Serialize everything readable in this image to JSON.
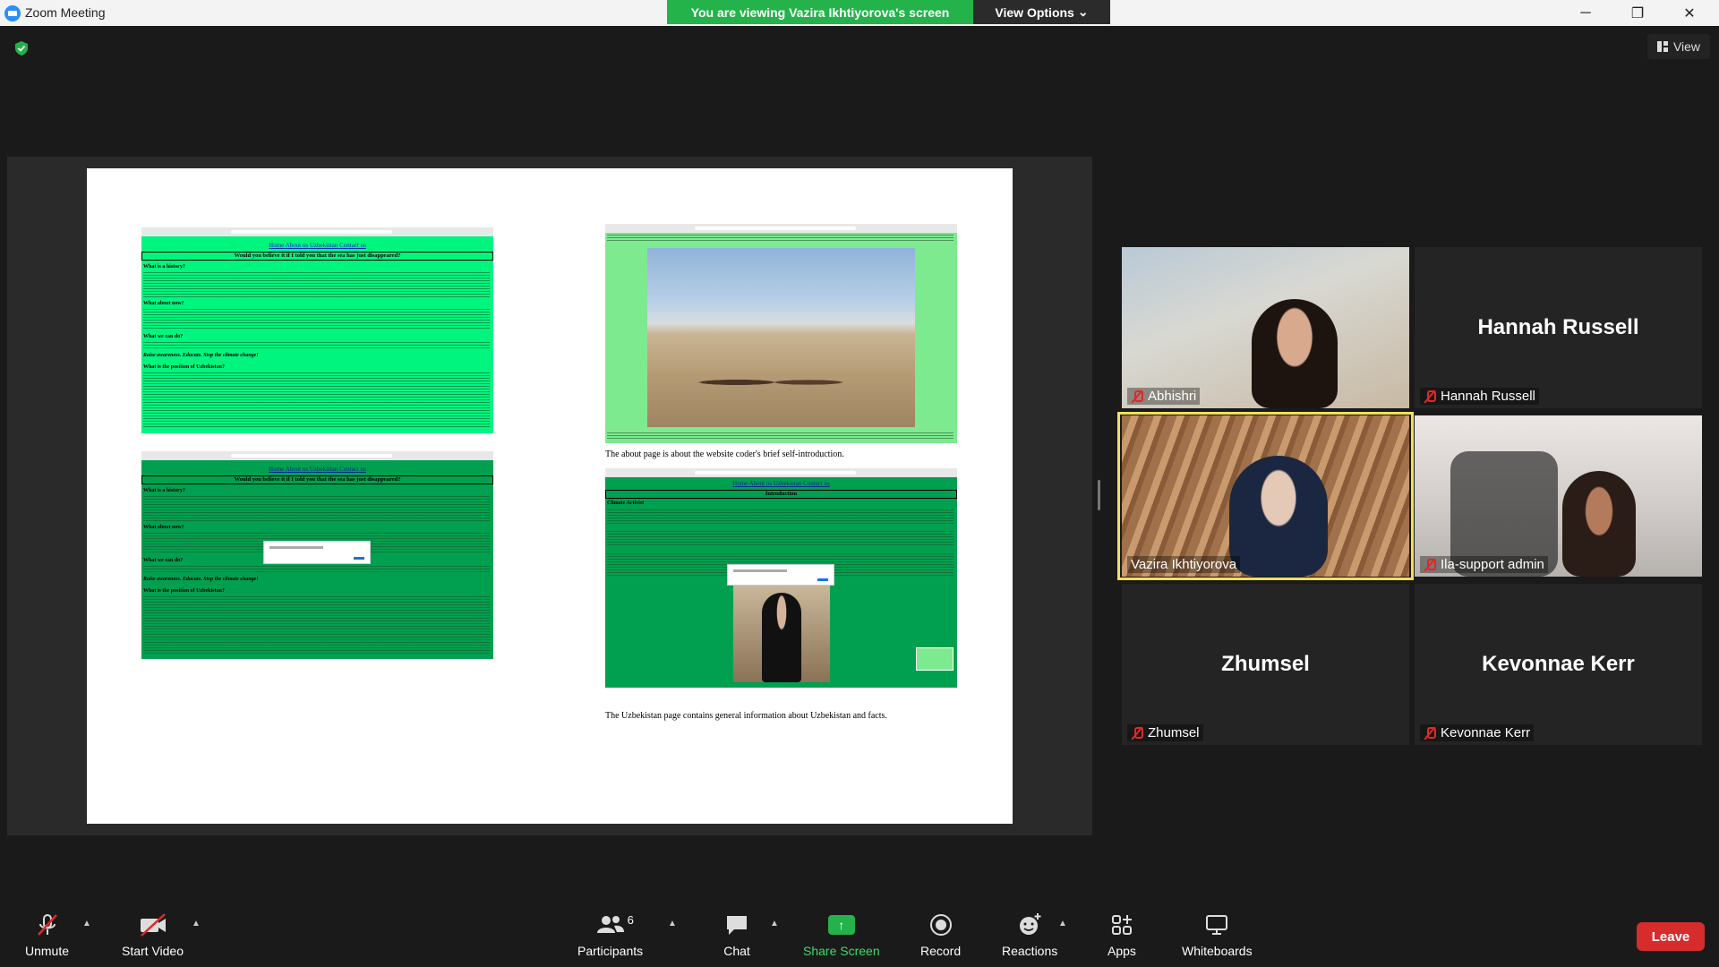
{
  "window": {
    "title": "Zoom Meeting",
    "controls": {
      "minimize": "─",
      "restore": "❐",
      "close": "✕"
    }
  },
  "banner": {
    "viewing_text": "You are viewing Vazira Ikhtiyorova's screen",
    "view_options_label": "View Options"
  },
  "view_button": {
    "label": "View"
  },
  "shared_slide": {
    "caption_about": "The about page is about the website coder's brief self-introduction.",
    "caption_uzbekistan": "The Uzbekistan page contains general information about Uzbekistan and facts.",
    "shot_nav": "Home About us Uzbekistan Contact us",
    "shot_heading": "Would you believe it if I told you that the sea has just disappeared?",
    "shot_sections": [
      "What is a history?",
      "What about now?",
      "What we can do?",
      "Raise awareness. Educate. Stop the climate change!",
      "What is the position of Uzbekistan?"
    ],
    "about_heading": "Introduction",
    "about_sub": "Climate Activist"
  },
  "participants": [
    {
      "name": "Abhishri",
      "muted": true,
      "video": true
    },
    {
      "name": "Hannah Russell",
      "muted": true,
      "video": false
    },
    {
      "name": "Vazira Ikhtiyorova",
      "muted": false,
      "video": true,
      "active_speaker": true
    },
    {
      "name": "Ila-support admin",
      "muted": true,
      "video": true
    },
    {
      "name": "Zhumsel",
      "muted": true,
      "video": false
    },
    {
      "name": "Kevonnae Kerr",
      "muted": true,
      "video": false
    }
  ],
  "toolbar": {
    "unmute": "Unmute",
    "start_video": "Start Video",
    "participants": "Participants",
    "participants_count": "6",
    "chat": "Chat",
    "share_screen": "Share Screen",
    "record": "Record",
    "reactions": "Reactions",
    "apps": "Apps",
    "whiteboards": "Whiteboards",
    "leave": "Leave"
  },
  "colors": {
    "banner_green": "#24b24b",
    "leave_red": "#d62c2c",
    "active_speaker_border": "#f1e05a",
    "muted_red": "#e02828"
  }
}
